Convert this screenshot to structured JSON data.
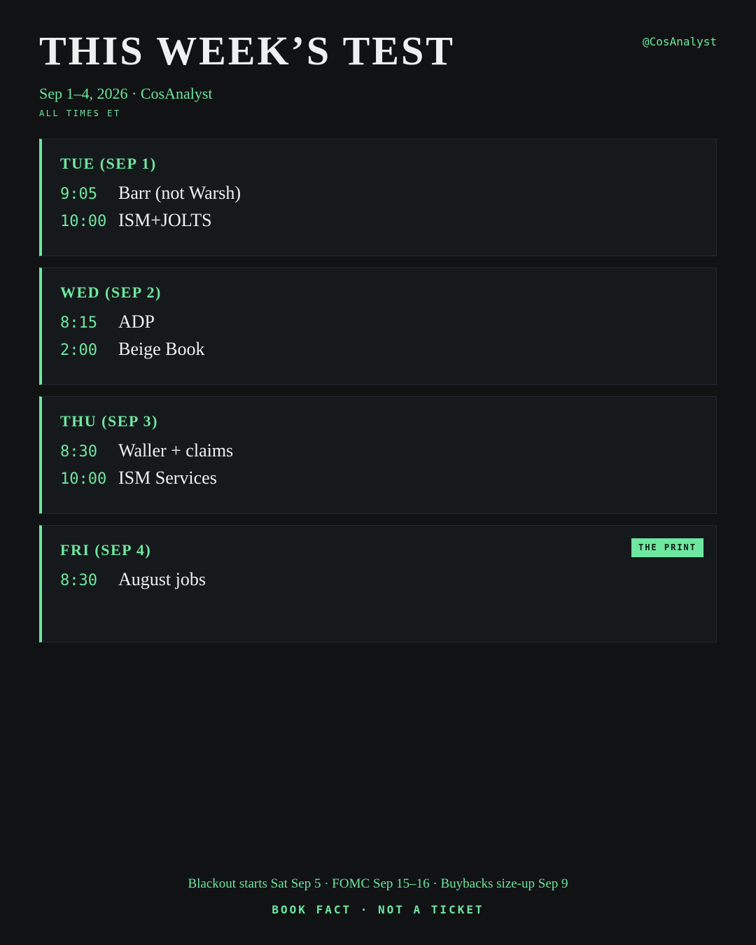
{
  "header": {
    "title": "THIS WEEK’S TEST",
    "handle": "@CosAnalyst",
    "subtitle": "Sep 1–4, 2026 · CosAnalyst",
    "timezone": "ALL TIMES ET"
  },
  "days": [
    {
      "label": "TUE (SEP 1)",
      "badge": "",
      "events": [
        {
          "time": "9:05",
          "name": "Barr (not Warsh)"
        },
        {
          "time": "10:00",
          "name": "ISM+JOLTS"
        }
      ]
    },
    {
      "label": "WED (SEP 2)",
      "badge": "",
      "events": [
        {
          "time": "8:15",
          "name": "ADP"
        },
        {
          "time": "2:00",
          "name": "Beige Book"
        }
      ]
    },
    {
      "label": "THU (SEP 3)",
      "badge": "",
      "events": [
        {
          "time": "8:30",
          "name": "Waller + claims"
        },
        {
          "time": "10:00",
          "name": "ISM Services"
        }
      ]
    },
    {
      "label": "FRI (SEP 4)",
      "badge": "THE PRINT",
      "events": [
        {
          "time": "8:30",
          "name": "August jobs"
        }
      ]
    }
  ],
  "footer": {
    "note": "Blackout starts Sat Sep 5 · FOMC Sep 15–16 · Buybacks size-up Sep 9",
    "tag": "BOOK FACT · NOT A TICKET"
  },
  "colors": {
    "background": "#111214",
    "card": "#16191c",
    "accent": "#6ee7a0",
    "text": "#f0f0f0"
  }
}
